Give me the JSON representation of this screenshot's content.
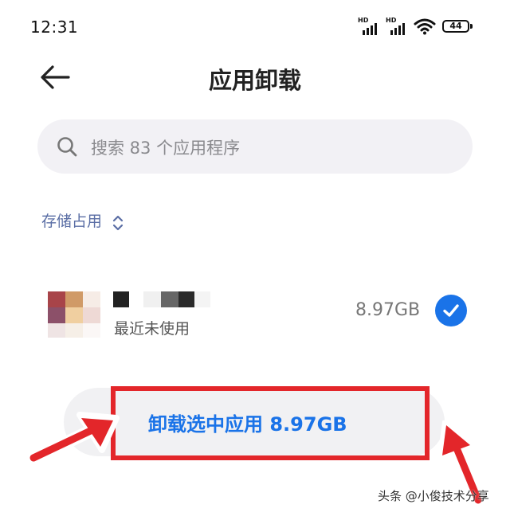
{
  "status_bar": {
    "time": "12:31",
    "signal_label": "HD",
    "battery": "44"
  },
  "header": {
    "title": "应用卸载",
    "back_icon": "arrow-left-icon"
  },
  "search": {
    "placeholder": "搜索 83 个应用程序",
    "icon": "search-icon"
  },
  "sort": {
    "label": "存储占用",
    "icon": "sort-toggle-icon"
  },
  "apps": [
    {
      "name": "",
      "subtitle": "最近未使用",
      "size": "8.97GB",
      "selected": true
    }
  ],
  "uninstall_button": {
    "label": "卸载选中应用 8.97GB"
  },
  "watermark": "头条 @小俊技术分享",
  "colors": {
    "accent": "#1a73e8",
    "annotation_red": "#e3262a",
    "sort_label": "#5a6ea5"
  }
}
